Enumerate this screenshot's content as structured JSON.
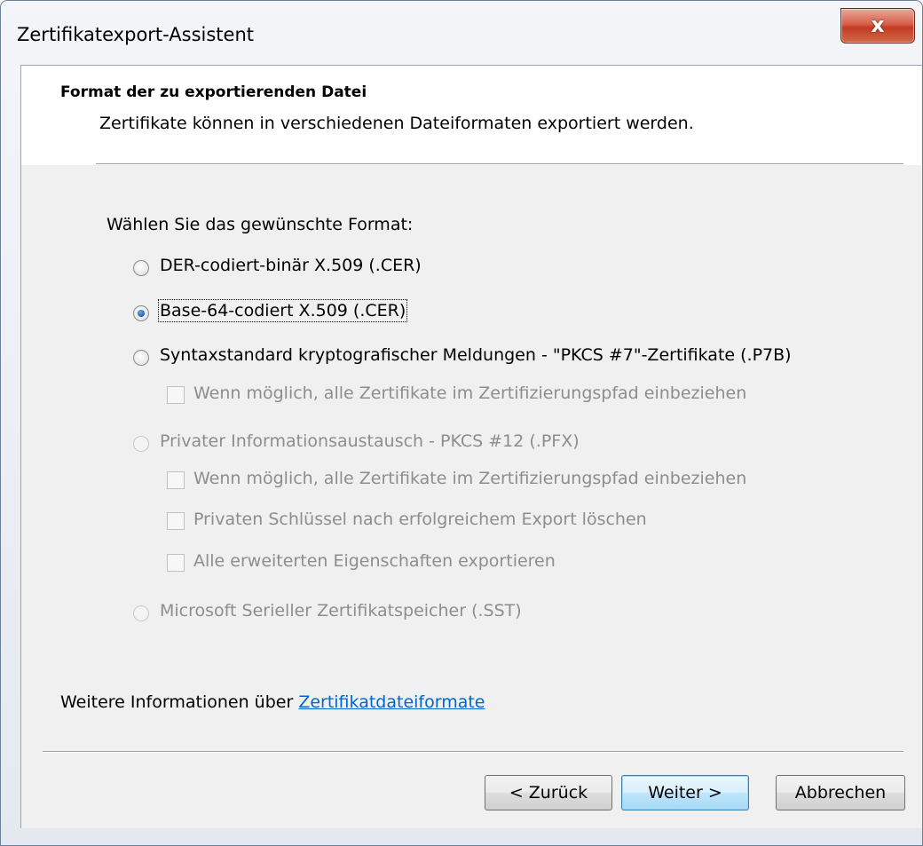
{
  "window": {
    "title": "Zertifikatexport-Assistent",
    "close_symbol": "x"
  },
  "header": {
    "title": "Format der zu exportierenden Datei",
    "subtitle": "Zertifikate können in verschiedenen Dateiformaten exportiert werden."
  },
  "prompt": "Wählen Sie das gewünschte Format:",
  "options": {
    "der": {
      "label": "DER-codiert-binär X.509 (.CER)",
      "checked": false,
      "enabled": true
    },
    "base64": {
      "label": "Base-64-codiert X.509 (.CER)",
      "checked": true,
      "enabled": true
    },
    "pkcs7": {
      "label": "Syntaxstandard kryptografischer Meldungen - \"PKCS #7\"-Zertifikate (.P7B)",
      "checked": false,
      "enabled": true
    },
    "pkcs7_include_all": {
      "label": "Wenn möglich, alle Zertifikate im Zertifizierungspfad einbeziehen",
      "checked": false,
      "enabled": false
    },
    "pfx": {
      "label": "Privater Informationsaustausch - PKCS #12 (.PFX)",
      "checked": false,
      "enabled": false
    },
    "pfx_include_all": {
      "label": "Wenn möglich, alle Zertifikate im Zertifizierungspfad einbeziehen",
      "checked": false,
      "enabled": false
    },
    "pfx_delete_key": {
      "label": "Privaten Schlüssel nach erfolgreichem Export löschen",
      "checked": false,
      "enabled": false
    },
    "pfx_export_props": {
      "label": "Alle erweiterten Eigenschaften exportieren",
      "checked": false,
      "enabled": false
    },
    "sst": {
      "label": "Microsoft Serieller Zertifikatspeicher (.SST)",
      "checked": false,
      "enabled": false
    }
  },
  "more_info": {
    "text": "Weitere Informationen über",
    "link": "Zertifikatdateiformate"
  },
  "buttons": {
    "back": "< Zurück",
    "next": "Weiter >",
    "cancel": "Abbrechen"
  }
}
